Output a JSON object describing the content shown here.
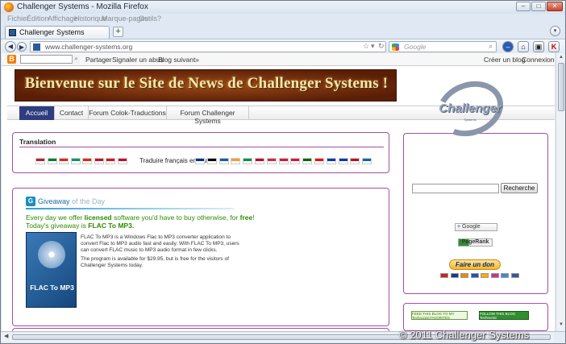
{
  "window": {
    "title": "Challenger Systems - Mozilla Firefox",
    "min": "–",
    "max": "□",
    "close": "✕"
  },
  "menu": [
    "Fichier",
    "Édition",
    "Affichage",
    "Historique",
    "Marque-pages",
    "Outils",
    "?"
  ],
  "tab": {
    "label": "Challenger Systems",
    "new_tab": "+"
  },
  "nav": {
    "url": "www.challenger-systems.org",
    "search_placeholder": "Google"
  },
  "blogger_bar": {
    "links": [
      "Partager",
      "Signaler un abus",
      "Blog suivant»"
    ],
    "right_links": [
      "Créer un blog",
      "Connexion"
    ]
  },
  "banner": {
    "text": "Bienvenue sur le Site de News de Challenger Systems !"
  },
  "site_nav": {
    "tabs": [
      "Accueil",
      "Contact",
      "Forum Colok-Traductions",
      "Forum Challenger Systems"
    ]
  },
  "translation": {
    "title": "Translation",
    "text": "Traduire français en Dutch",
    "flags_left": [
      "#b22234",
      "#007a3d",
      "#de2910",
      "#00966e",
      "#de2910",
      "#c8102e",
      "#d7141a",
      "#c60c30"
    ],
    "flags_right": [
      "#003580",
      "#000000",
      "#0d5eaf",
      "#ff9933",
      "#009246",
      "#bc002d",
      "#cd2e3a",
      "#dc143c",
      "#dc143c",
      "#006600",
      "#ff0000",
      "#0039a6",
      "#0039a6",
      "#c60b1e",
      "#006aa7"
    ]
  },
  "giveaway": {
    "title_main": "Giveaway",
    "title_rest": " of the Day",
    "line1_pre": "Every day we offer ",
    "line1_bold": "licensed",
    "line1_post": " software you'd have to buy otherwise, for ",
    "line1_free": "free",
    "line1_end": "!",
    "line2_pre": "Today's giveaway is ",
    "line2_bold": "FLAC To MP3.",
    "box_label": "FLAC To MP3",
    "desc1": "FLAC To MP3 is a Windows Flac to MP3 converter application to convert Flac to MP3 audio fast and easily. With FLAC To MP3, users can convert FLAC music to MP3 audio format in few clicks.",
    "desc2": "The program is available for $29.95, but is free for the visitors of Challenger Systems today."
  },
  "sidebar": {
    "logo_text": "Challenger",
    "logo_sub": "Systems",
    "google_btn": "+ Google",
    "pagerank": "PageRank",
    "search_button": "Recherche",
    "donate": "Faire un don",
    "badges": [
      "FEED THIS BLOG TO MY Technorati FAVORITES",
      "FOLLOW THIS BLOG Technorati"
    ]
  },
  "watermark": "© 2011 Challenger Systems"
}
